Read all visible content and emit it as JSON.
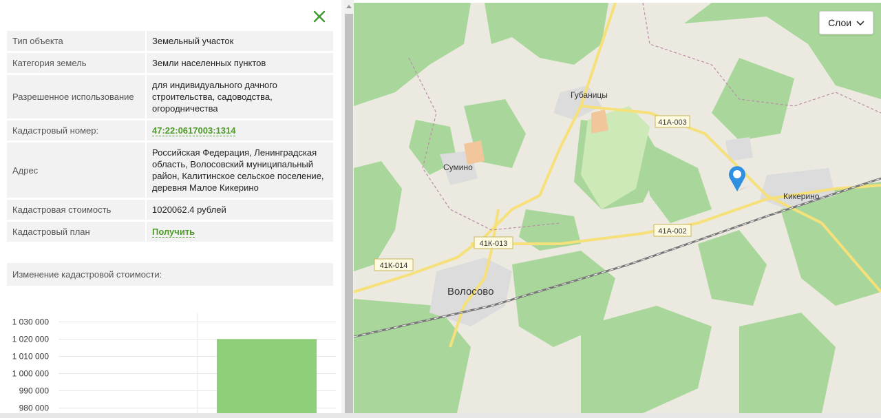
{
  "panel": {
    "rows": [
      {
        "label": "Тип объекта",
        "value": "Земельный участок",
        "link": false
      },
      {
        "label": "Категория земель",
        "value": "Земли населенных пунктов",
        "link": false
      },
      {
        "label": "Разрешенное использование",
        "value": "для индивидуального дачного строительства, садоводства, огородничества",
        "link": false
      },
      {
        "label": "Кадастровый номер:",
        "value": "47:22:0617003:1314",
        "link": true
      },
      {
        "label": "Адрес",
        "value": "Российская Федерация, Ленинградская область, Волосовский муниципальный район, Калитинское сельское поселение, деревня Малое Кикерино",
        "link": false
      },
      {
        "label": "Кадастровая стоимость",
        "value": "1020062.4 рублей",
        "link": false
      },
      {
        "label": "Кадастровый план",
        "value": "Получить",
        "link": true
      }
    ],
    "change_heading": "Изменение кадастровой стоимости:"
  },
  "chart_data": {
    "type": "bar",
    "categories": [
      ""
    ],
    "values": [
      1020062.4
    ],
    "ylim": [
      975000,
      1035000
    ],
    "yticks": [
      "1 030 000",
      "1 020 000",
      "1 010 000",
      "1 000 000",
      "990 000",
      "980 000"
    ],
    "ytick_values": [
      1030000,
      1020000,
      1010000,
      1000000,
      990000,
      980000
    ],
    "bar_color": "#8fcf7a",
    "title": "",
    "xlabel": "",
    "ylabel": ""
  },
  "map": {
    "layers_label": "Слои",
    "places": [
      "Губаницы",
      "Сумино",
      "Кикерино",
      "Волосово"
    ],
    "roads": [
      "41А-003",
      "41А-002",
      "41К-013",
      "41К-014"
    ],
    "marker_color": "#2f8fe0"
  },
  "colors": {
    "accent": "#4f9a2a",
    "close": "#3c9a2e",
    "forest": "#a9d79b"
  }
}
